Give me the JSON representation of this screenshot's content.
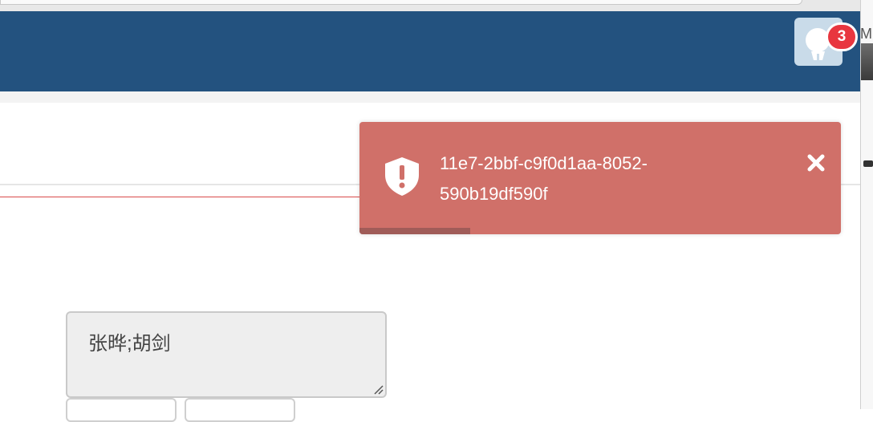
{
  "header": {
    "bg_color": "#23527f",
    "notification_count": "3",
    "avatar_icon": "user-avatar-icon"
  },
  "toast": {
    "type": "error",
    "bg_color": "#d07069",
    "icon": "shield-exclamation-icon",
    "message": "11e7-2bbf-c9f0d1aa-8052-590b19df590f",
    "close_icon": "close-icon",
    "progress_fraction": 0.23
  },
  "form": {
    "textarea_value": "张晔;胡剑"
  },
  "right_edge": {
    "text": "M"
  }
}
